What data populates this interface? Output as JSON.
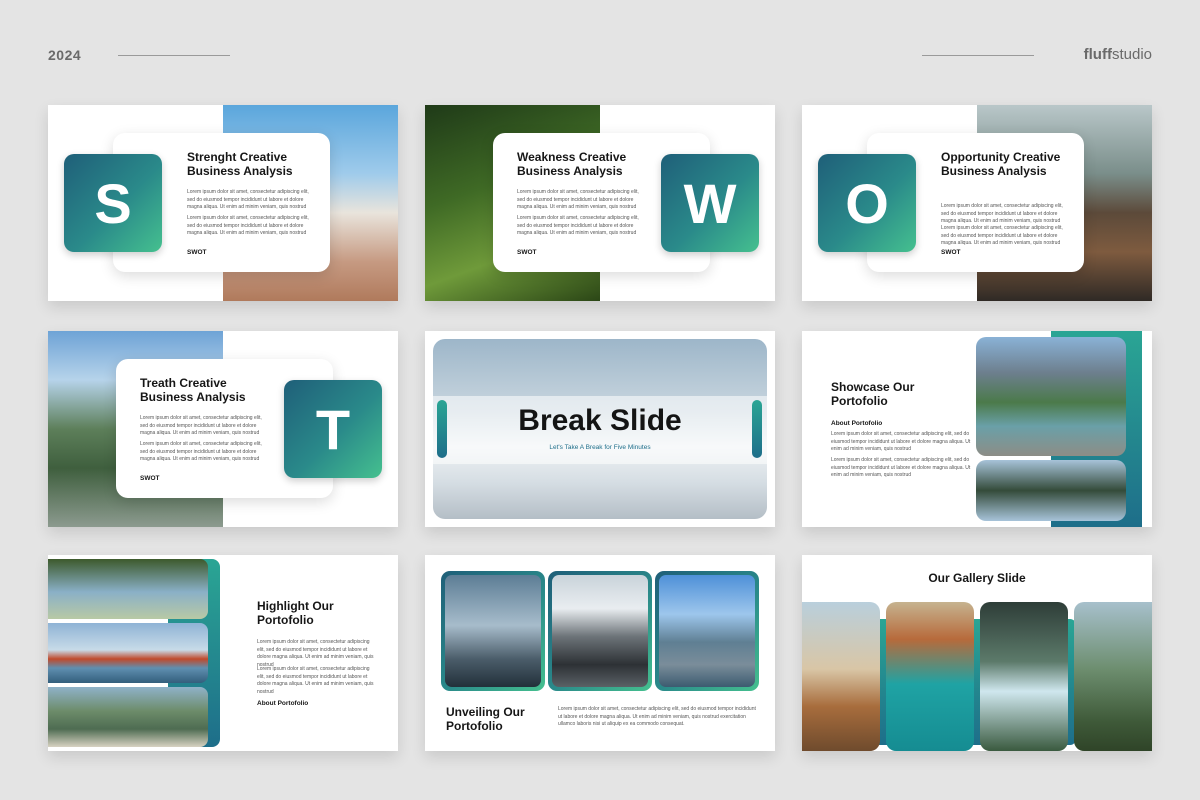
{
  "header": {
    "year": "2024",
    "brand_bold": "fluff",
    "brand_rest": "studio"
  },
  "lorem": {
    "p1": "Lorem ipsum dolor sit amet, consectetur adipiscing elit, sed do eiusmod tempor incididunt ut labore et dolore magna aliqua. Ut enim ad minim veniam, quis nostrud",
    "p2": "Lorem ipsum dolor sit amet, consectetur adipiscing elit, sed do eiusmod tempor incididunt ut labore et dolore magna aliqua. Ut enim ad minim veniam, quis nostrud",
    "p3": "Lorem ipsum dolor sit amet, consectetur adipiscing elit, sed do eiusmod tempor incididunt ut labore et dolore magna aliqua. Ut enim ad minim veniam, quis nostrud exercitation ullamco laboris nisi ut aliquip ex ea commodo consequat."
  },
  "slides": {
    "s": {
      "letter": "S",
      "title": "Strenght Creative Business Analysis",
      "tag": "SWOT"
    },
    "w": {
      "letter": "W",
      "title": "Weakness Creative Business Analysis",
      "tag": "SWOT"
    },
    "o": {
      "letter": "O",
      "title": "Opportunity Creative Business Analysis",
      "tag": "SWOT"
    },
    "t": {
      "letter": "T",
      "title": "Treath Creative Business Analysis",
      "tag": "SWOT"
    },
    "break": {
      "title": "Break Slide",
      "subtitle": "Let's Take A Break for Five Minutes"
    },
    "showcase": {
      "title": "Showcase Our Portofolio",
      "subtitle": "About Portofolio"
    },
    "highlight": {
      "title": "Highlight Our Portofolio",
      "subtitle": "About Portofolio"
    },
    "unveiling": {
      "title": "Unveiling Our Portofolio"
    },
    "gallery": {
      "title": "Our Gallery Slide"
    }
  },
  "colors": {
    "accent_dark": "#1f5f79",
    "accent_light": "#45c08f",
    "background": "#e4e4e4"
  }
}
